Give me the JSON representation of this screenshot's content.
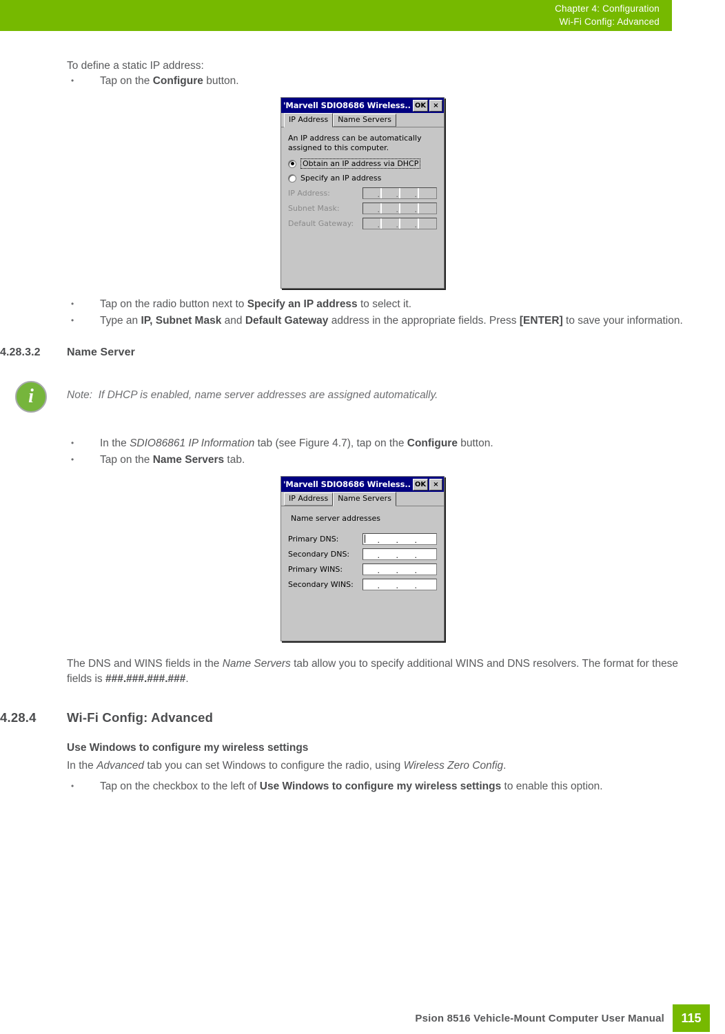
{
  "header": {
    "line1": "Chapter 4:  Configuration",
    "line2": "Wi-Fi Config: Advanced"
  },
  "intro": {
    "lead": "To define a static IP address:",
    "bullet1_pre": "Tap on the ",
    "bullet1_bold": "Configure",
    "bullet1_post": " button."
  },
  "dialog_ip": {
    "title": "'Marvell SDIO8686 Wireless...",
    "ok_label": "OK",
    "close_label": "×",
    "tabs": [
      {
        "label": "IP Address",
        "active": true
      },
      {
        "label": "Name Servers",
        "active": false
      }
    ],
    "description": "An IP address can be automatically assigned to this computer.",
    "radio_dhcp": "Obtain an IP address via DHCP",
    "radio_static": "Specify an IP address",
    "fields": [
      {
        "label": "IP Address:",
        "value": "",
        "enabled": false
      },
      {
        "label": "Subnet Mask:",
        "value": "",
        "enabled": false
      },
      {
        "label": "Default Gateway:",
        "value": "",
        "enabled": false
      }
    ]
  },
  "after_dialog_bullets": {
    "b1_pre": "Tap on the radio button next to ",
    "b1_bold": "Specify an IP address",
    "b1_post": " to select it.",
    "b2_pre": "Type an ",
    "b2_bold1": "IP, Subnet Mask",
    "b2_mid": " and ",
    "b2_bold2": "Default Gateway",
    "b2_post": " address in the appropriate fields. Press ",
    "b2_bold3": "[ENTER]",
    "b2_end": " to save your information."
  },
  "section_name_server": {
    "number": "4.28.3.2",
    "title": "Name Server"
  },
  "note": {
    "icon_glyph": "i",
    "label": "Note:",
    "text": "If DHCP is enabled, name server addresses are assigned automatically."
  },
  "name_server_bullets": {
    "b1_pre": "In the ",
    "b1_italic": "SDIO86861 IP Information",
    "b1_mid": " tab (see Figure 4.7), tap on the ",
    "b1_bold": "Configure",
    "b1_post": " button.",
    "b2_pre": "Tap on the ",
    "b2_bold": "Name Servers",
    "b2_post": " tab."
  },
  "dialog_ns": {
    "title": "'Marvell SDIO8686 Wireless...",
    "ok_label": "OK",
    "close_label": "×",
    "tabs": [
      {
        "label": "IP Address",
        "active": false
      },
      {
        "label": "Name Servers",
        "active": true
      }
    ],
    "section_label": "Name server addresses",
    "fields": [
      {
        "label": "Primary DNS:",
        "value": "",
        "enabled": true,
        "focused": true
      },
      {
        "label": "Secondary DNS:",
        "value": "",
        "enabled": true,
        "focused": false
      },
      {
        "label": "Primary WINS:",
        "value": "",
        "enabled": true,
        "focused": false
      },
      {
        "label": "Secondary WINS:",
        "value": "",
        "enabled": true,
        "focused": false
      }
    ]
  },
  "ns_paragraph": {
    "pre": "The DNS and WINS fields in the ",
    "italic": "Name Servers",
    "mid": " tab allow you to specify additional WINS and DNS resolvers. The format for these fields is ",
    "bold": "###.###.###.###",
    "post": "."
  },
  "section_advanced": {
    "number": "4.28.4",
    "title": "Wi-Fi Config: Advanced",
    "subheading": "Use Windows to configure my wireless settings",
    "para_pre": "In the ",
    "para_italic1": "Advanced",
    "para_mid": " tab you can set Windows to configure the radio, using ",
    "para_italic2": "Wireless Zero Config",
    "para_post": ".",
    "bullet_pre": "Tap on the checkbox to the left of ",
    "bullet_bold": "Use Windows to configure my wireless settings",
    "bullet_post": " to enable this option."
  },
  "footer": {
    "text": "Psion 8516 Vehicle-Mount Computer User Manual",
    "page_number": "115"
  },
  "colors": {
    "brand_green": "#76b900",
    "note_green": "#76b53c",
    "title_bar_blue": "#000080",
    "dialog_grey": "#c6c6c6",
    "body_text": "#58595b"
  }
}
